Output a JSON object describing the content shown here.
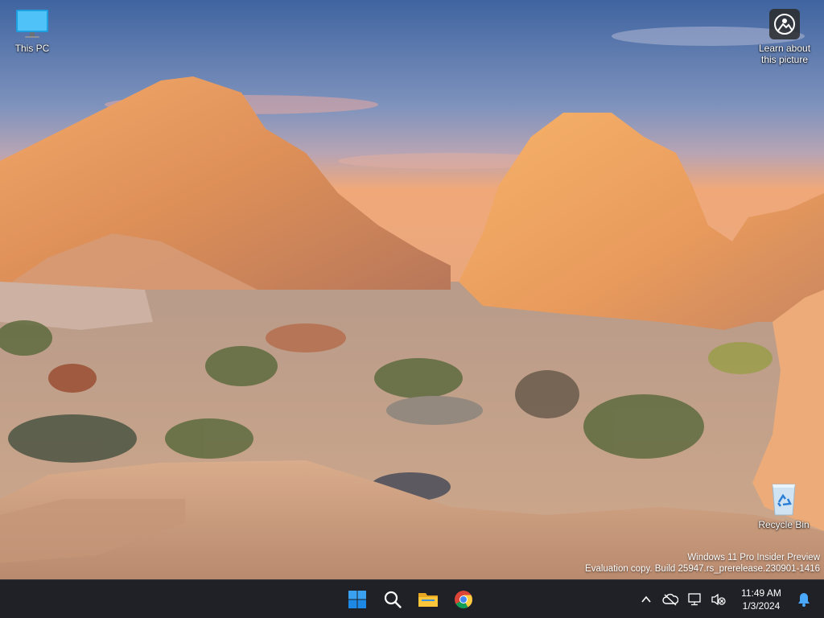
{
  "desktop": {
    "icons": [
      {
        "label": "This PC",
        "icon": "monitor-icon"
      },
      {
        "label": "Learn about this picture",
        "icon": "camera-spotlight-icon"
      },
      {
        "label": "Recycle Bin",
        "icon": "recycle-bin-icon"
      }
    ],
    "watermark": {
      "line1": "Windows 11 Pro Insider Preview",
      "line2": "Evaluation copy. Build 25947.rs_prerelease.230901-1416"
    }
  },
  "taskbar": {
    "pinned": [
      {
        "name": "start",
        "icon": "windows-logo-icon"
      },
      {
        "name": "search",
        "icon": "search-icon"
      },
      {
        "name": "file-explorer",
        "icon": "folder-icon"
      },
      {
        "name": "chrome",
        "icon": "chrome-icon"
      }
    ],
    "tray": {
      "icons": [
        "chevron-up-icon",
        "cloud-offline-icon",
        "network-icon",
        "volume-muted-icon",
        "notification-bell-icon"
      ],
      "time": "11:49 AM",
      "date": "1/3/2024"
    },
    "colors": {
      "background": "#1f2127",
      "accent": "#0078d4"
    }
  }
}
